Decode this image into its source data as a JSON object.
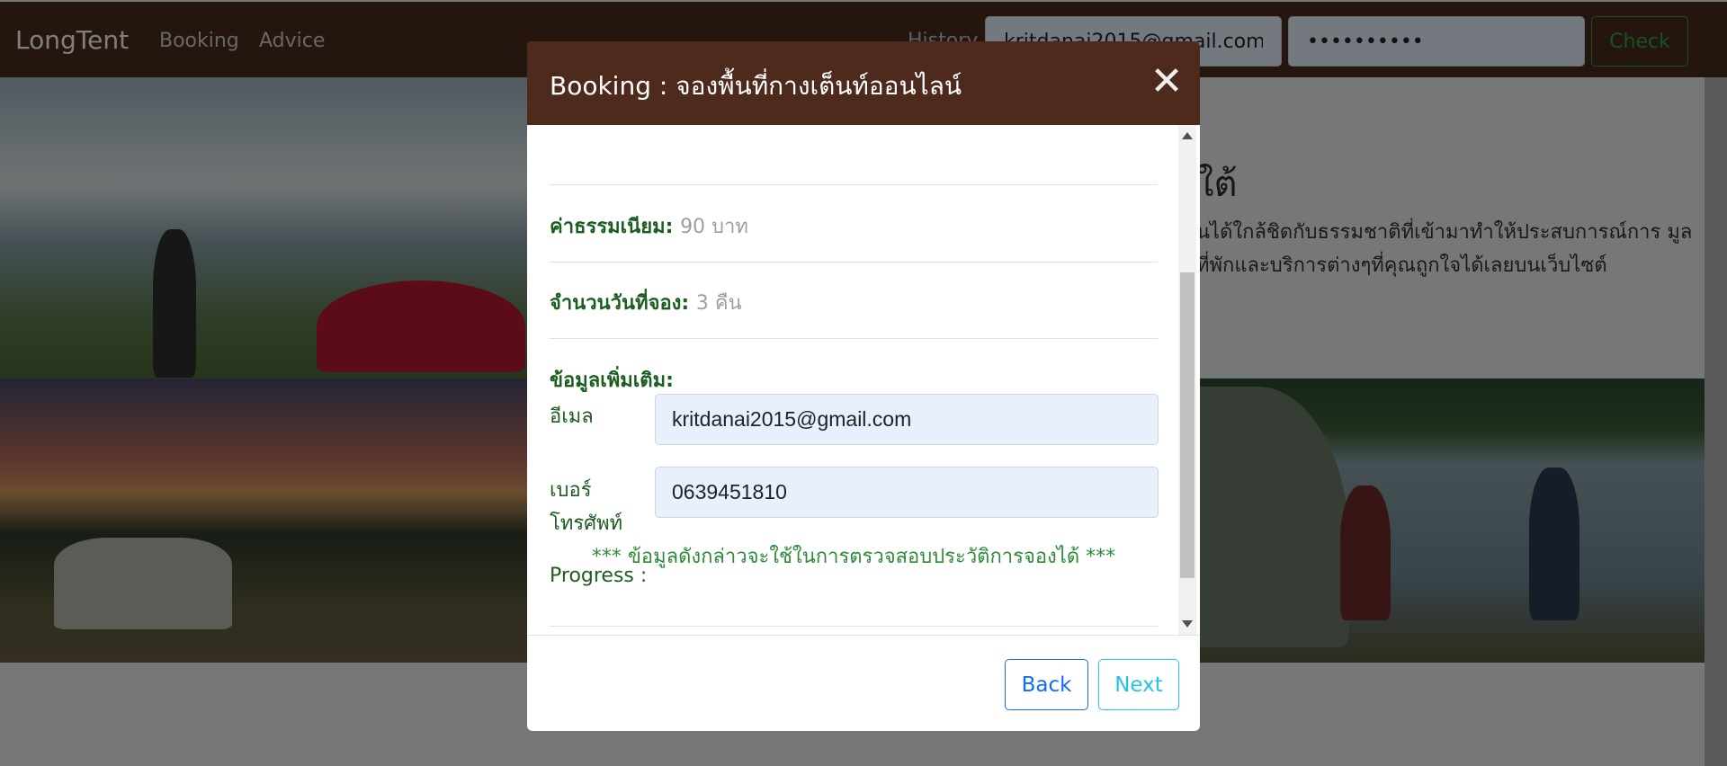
{
  "navbar": {
    "brand": "LongTent",
    "links": [
      "Booking",
      "Advice"
    ],
    "history_label": "History",
    "email_value": "kritdanai2015@gmail.com",
    "password_value": "••••••••••",
    "check_label": "Check"
  },
  "hero": {
    "title": "ใต้",
    "text": "นได้ใกล้ชิดกับธรรมชาติที่เข้ามาทำให้ประสบการณ์การ มูลที่พักและบริการต่างๆที่คุณถูกใจได้เลยบนเว็บไซต์"
  },
  "modal": {
    "title": "Booking : จองพื้นที่กางเต็นท์ออนไลน์",
    "close_symbol": "✕",
    "fee_label": "ค่าธรรมเนียม:",
    "fee_value": "90 บาท",
    "nights_label": "จำนวนวันที่จอง:",
    "nights_value": "3 คืน",
    "extra_info_label": "ข้อมูลเพิ่มเติม:",
    "email_label": "อีเมล",
    "email_value": "kritdanai2015@gmail.com",
    "phone_label": "เบอร์ โทรศัพท์",
    "phone_value": "0639451810",
    "note": "*** ข้อมูลดังกล่าวจะใช้ในการตรวจสอบประวัติการจองได้ ***",
    "progress_label": "Progress :",
    "back_label": "Back",
    "next_label": "Next"
  },
  "colors": {
    "navbar": "#4a2a1e",
    "modal_header": "#4e2a1c",
    "label_green": "#1b5e20",
    "input_bg": "#e8f0fe",
    "back_blue": "#0d6efd",
    "next_cyan": "#22c5e6"
  }
}
